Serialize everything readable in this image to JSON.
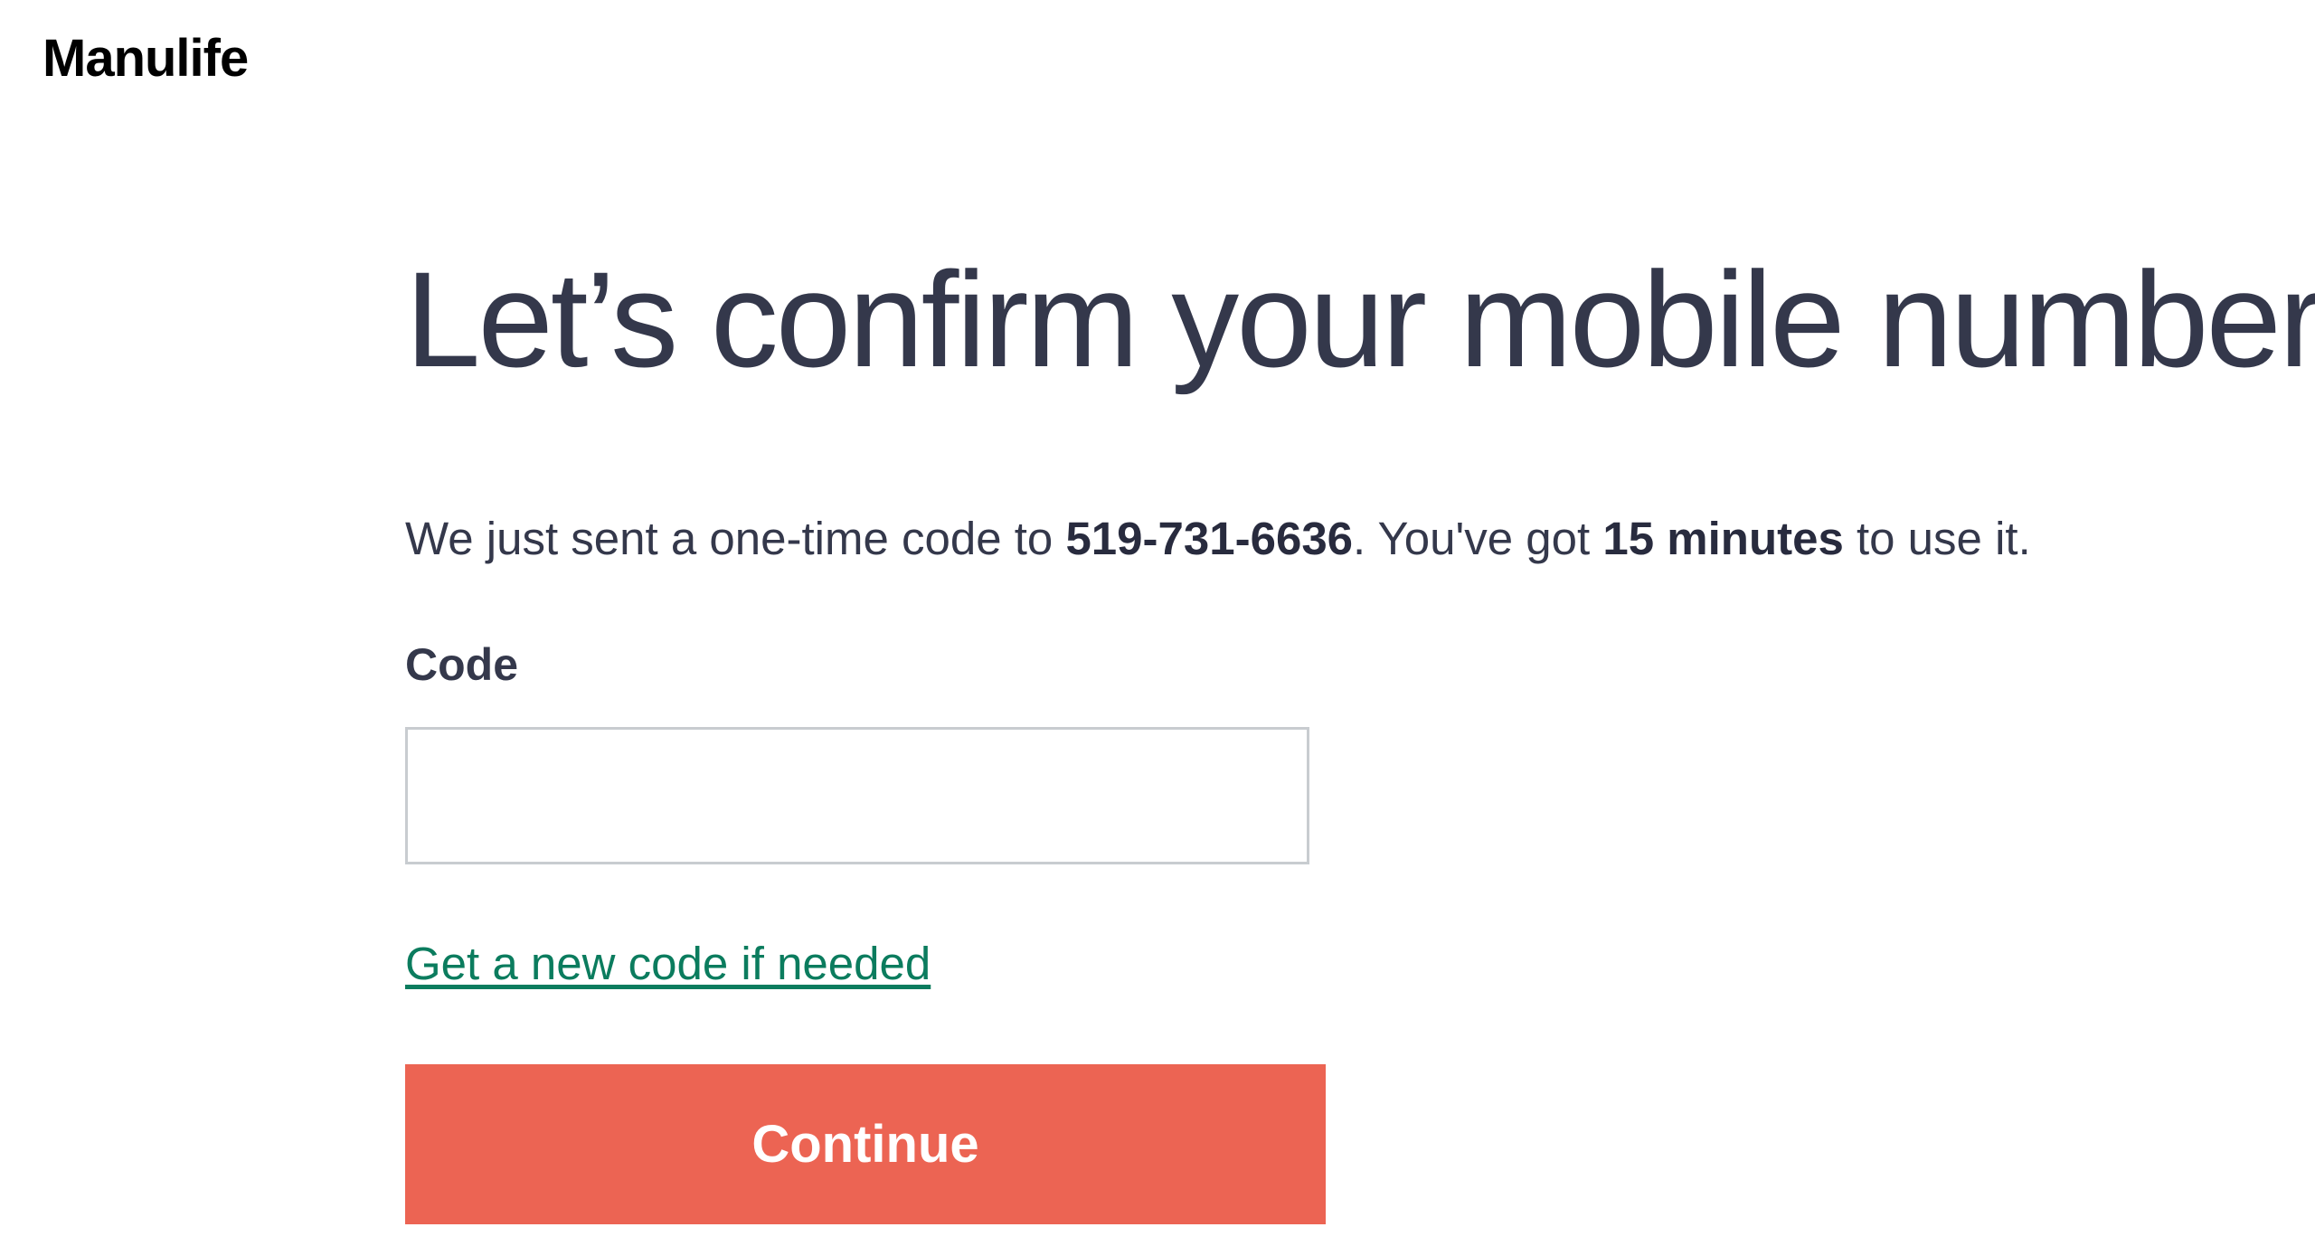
{
  "brand": {
    "logo_text": "Manulife"
  },
  "page": {
    "title": "Let’s confirm your mobile number",
    "intro": {
      "part1": "We just sent a one-time code to ",
      "phone": "519-731-6636",
      "part2": ". You've got ",
      "duration": "15 minutes",
      "part3": " to use it."
    }
  },
  "form": {
    "code_label": "Code",
    "code_value": "",
    "new_code_link": "Get a new code if needed",
    "continue_label": "Continue"
  },
  "colors": {
    "primary_button": "#ec6453",
    "link": "#0b7c5e",
    "text": "#34384b"
  }
}
